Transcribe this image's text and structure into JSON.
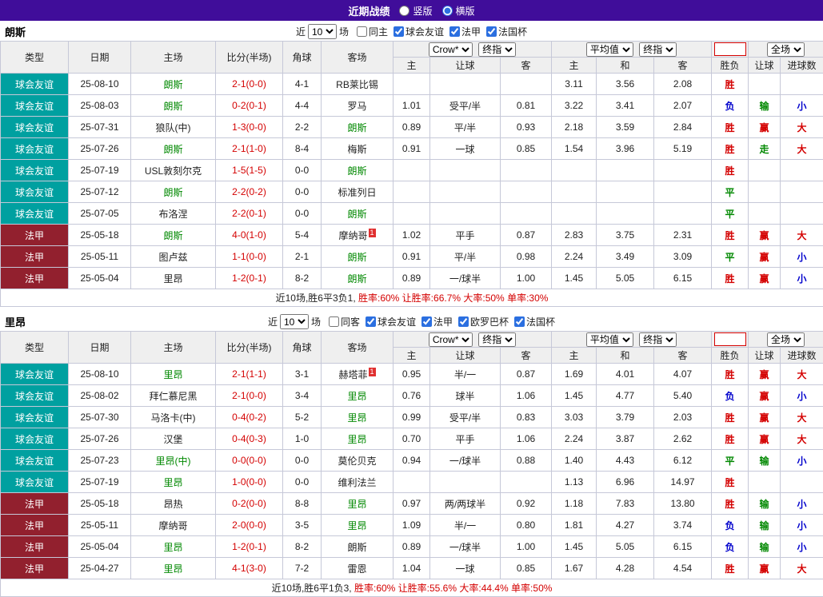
{
  "topbar": {
    "title": "近期战绩",
    "radios": [
      {
        "label": "竖版",
        "checked": false
      },
      {
        "label": "横版",
        "checked": true
      }
    ]
  },
  "table_header": {
    "cols": [
      "类型",
      "日期",
      "主场",
      "比分(半场)",
      "角球",
      "客场"
    ],
    "dropdowns": {
      "company": "Crow*",
      "final1": "终指",
      "average": "平均值",
      "final2": "终指",
      "fulltime": "全场"
    },
    "sub": [
      "主",
      "让球",
      "客",
      "主",
      "和",
      "客",
      "胜负",
      "让球",
      "进球数"
    ]
  },
  "colors": {
    "topbar_purple": "#400d9a",
    "type_friendly_teal": "#00a0a0",
    "type_league_maroon": "#92202e",
    "focus_team_green": "#008800",
    "score_red": "#d40000",
    "win_red": "#d40000",
    "lose_blue": "#0000cc",
    "draw_green": "#008800"
  },
  "sections": [
    {
      "team": "朗斯",
      "filter": {
        "prefix": "近",
        "count": "10",
        "suffix": "场",
        "checkboxes": [
          {
            "label": "同主",
            "checked": false
          },
          {
            "label": "球会友谊",
            "checked": true
          },
          {
            "label": "法甲",
            "checked": true
          },
          {
            "label": "法国杯",
            "checked": true
          }
        ]
      },
      "rows": [
        {
          "type": "球会友谊",
          "date": "25-08-10",
          "home": "朗斯",
          "home_focus": true,
          "score": "2-1(0-0)",
          "corner": "4-1",
          "away": "RB莱比锡",
          "odds": [
            "",
            "",
            ""
          ],
          "avg": [
            "3.11",
            "3.56",
            "2.08"
          ],
          "result": [
            "胜",
            "",
            ""
          ]
        },
        {
          "type": "球会友谊",
          "date": "25-08-03",
          "home": "朗斯",
          "home_focus": true,
          "score": "0-2(0-1)",
          "corner": "4-4",
          "away": "罗马",
          "odds": [
            "1.01",
            "受平/半",
            "0.81"
          ],
          "avg": [
            "3.22",
            "3.41",
            "2.07"
          ],
          "result": [
            "负",
            "输",
            "小"
          ]
        },
        {
          "type": "球会友谊",
          "date": "25-07-31",
          "home": "狼队(中)",
          "score": "1-3(0-0)",
          "corner": "2-2",
          "away": "朗斯",
          "away_focus": true,
          "odds": [
            "0.89",
            "平/半",
            "0.93"
          ],
          "avg": [
            "2.18",
            "3.59",
            "2.84"
          ],
          "result": [
            "胜",
            "赢",
            "大"
          ]
        },
        {
          "type": "球会友谊",
          "date": "25-07-26",
          "home": "朗斯",
          "home_focus": true,
          "score": "2-1(1-0)",
          "corner": "8-4",
          "away": "梅斯",
          "odds": [
            "0.91",
            "一球",
            "0.85"
          ],
          "avg": [
            "1.54",
            "3.96",
            "5.19"
          ],
          "result": [
            "胜",
            "走",
            "大"
          ]
        },
        {
          "type": "球会友谊",
          "date": "25-07-19",
          "home": "USL敦刻尔克",
          "score": "1-5(1-5)",
          "corner": "0-0",
          "away": "朗斯",
          "away_focus": true,
          "odds": [
            "",
            "",
            ""
          ],
          "avg": [
            "",
            "",
            ""
          ],
          "result": [
            "胜",
            "",
            ""
          ]
        },
        {
          "type": "球会友谊",
          "date": "25-07-12",
          "home": "朗斯",
          "home_focus": true,
          "score": "2-2(0-2)",
          "corner": "0-0",
          "away": "标准列日",
          "odds": [
            "",
            "",
            ""
          ],
          "avg": [
            "",
            "",
            ""
          ],
          "result": [
            "平",
            "",
            ""
          ]
        },
        {
          "type": "球会友谊",
          "date": "25-07-05",
          "home": "布洛涅",
          "score": "2-2(0-1)",
          "corner": "0-0",
          "away": "朗斯",
          "away_focus": true,
          "odds": [
            "",
            "",
            ""
          ],
          "avg": [
            "",
            "",
            ""
          ],
          "result": [
            "平",
            "",
            ""
          ]
        },
        {
          "type": "法甲",
          "date": "25-05-18",
          "home": "朗斯",
          "home_focus": true,
          "score": "4-0(1-0)",
          "corner": "5-4",
          "away": "摩纳哥",
          "away_sup": "1",
          "odds": [
            "1.02",
            "平手",
            "0.87"
          ],
          "avg": [
            "2.83",
            "3.75",
            "2.31"
          ],
          "result": [
            "胜",
            "赢",
            "大"
          ]
        },
        {
          "type": "法甲",
          "date": "25-05-11",
          "home": "图卢兹",
          "score": "1-1(0-0)",
          "corner": "2-1",
          "away": "朗斯",
          "away_focus": true,
          "odds": [
            "0.91",
            "平/半",
            "0.98"
          ],
          "avg": [
            "2.24",
            "3.49",
            "3.09"
          ],
          "result": [
            "平",
            "赢",
            "小"
          ]
        },
        {
          "type": "法甲",
          "date": "25-05-04",
          "home": "里昂",
          "score": "1-2(0-1)",
          "corner": "8-2",
          "away": "朗斯",
          "away_focus": true,
          "odds": [
            "0.89",
            "一/球半",
            "1.00"
          ],
          "avg": [
            "1.45",
            "5.05",
            "6.15"
          ],
          "result": [
            "胜",
            "赢",
            "小"
          ]
        }
      ],
      "summary": {
        "record": "近10场,胜6平3负1,",
        "stats": "胜率:60% 让胜率:66.7% 大率:50% 单率:30%"
      }
    },
    {
      "team": "里昂",
      "filter": {
        "prefix": "近",
        "count": "10",
        "suffix": "场",
        "checkboxes": [
          {
            "label": "同客",
            "checked": false
          },
          {
            "label": "球会友谊",
            "checked": true
          },
          {
            "label": "法甲",
            "checked": true
          },
          {
            "label": "欧罗巴杯",
            "checked": true
          },
          {
            "label": "法国杯",
            "checked": true
          }
        ]
      },
      "rows": [
        {
          "type": "球会友谊",
          "date": "25-08-10",
          "home": "里昂",
          "home_focus": true,
          "score": "2-1(1-1)",
          "corner": "3-1",
          "away": "赫塔菲",
          "away_sup": "1",
          "odds": [
            "0.95",
            "半/一",
            "0.87"
          ],
          "avg": [
            "1.69",
            "4.01",
            "4.07"
          ],
          "result": [
            "胜",
            "赢",
            "大"
          ]
        },
        {
          "type": "球会友谊",
          "date": "25-08-02",
          "home": "拜仁慕尼黑",
          "score": "2-1(0-0)",
          "corner": "3-4",
          "away": "里昂",
          "away_focus": true,
          "odds": [
            "0.76",
            "球半",
            "1.06"
          ],
          "avg": [
            "1.45",
            "4.77",
            "5.40"
          ],
          "result": [
            "负",
            "赢",
            "小"
          ]
        },
        {
          "type": "球会友谊",
          "date": "25-07-30",
          "home": "马洛卡(中)",
          "score": "0-4(0-2)",
          "corner": "5-2",
          "away": "里昂",
          "away_focus": true,
          "odds": [
            "0.99",
            "受平/半",
            "0.83"
          ],
          "avg": [
            "3.03",
            "3.79",
            "2.03"
          ],
          "result": [
            "胜",
            "赢",
            "大"
          ]
        },
        {
          "type": "球会友谊",
          "date": "25-07-26",
          "home": "汉堡",
          "score": "0-4(0-3)",
          "corner": "1-0",
          "away": "里昂",
          "away_focus": true,
          "odds": [
            "0.70",
            "平手",
            "1.06"
          ],
          "avg": [
            "2.24",
            "3.87",
            "2.62"
          ],
          "result": [
            "胜",
            "赢",
            "大"
          ]
        },
        {
          "type": "球会友谊",
          "date": "25-07-23",
          "home": "里昂(中)",
          "home_focus": true,
          "score": "0-0(0-0)",
          "corner": "0-0",
          "away": "莫伦贝克",
          "odds": [
            "0.94",
            "一/球半",
            "0.88"
          ],
          "avg": [
            "1.40",
            "4.43",
            "6.12"
          ],
          "result": [
            "平",
            "输",
            "小"
          ]
        },
        {
          "type": "球会友谊",
          "date": "25-07-19",
          "home": "里昂",
          "home_focus": true,
          "score": "1-0(0-0)",
          "corner": "0-0",
          "away": "维利法兰",
          "odds": [
            "",
            "",
            ""
          ],
          "avg": [
            "1.13",
            "6.96",
            "14.97"
          ],
          "result": [
            "胜",
            "",
            ""
          ]
        },
        {
          "type": "法甲",
          "date": "25-05-18",
          "home": "昂热",
          "score": "0-2(0-0)",
          "corner": "8-8",
          "away": "里昂",
          "away_focus": true,
          "odds": [
            "0.97",
            "两/两球半",
            "0.92"
          ],
          "avg": [
            "1.18",
            "7.83",
            "13.80"
          ],
          "result": [
            "胜",
            "输",
            "小"
          ]
        },
        {
          "type": "法甲",
          "date": "25-05-11",
          "home": "摩纳哥",
          "score": "2-0(0-0)",
          "corner": "3-5",
          "away": "里昂",
          "away_focus": true,
          "odds": [
            "1.09",
            "半/一",
            "0.80"
          ],
          "avg": [
            "1.81",
            "4.27",
            "3.74"
          ],
          "result": [
            "负",
            "输",
            "小"
          ]
        },
        {
          "type": "法甲",
          "date": "25-05-04",
          "home": "里昂",
          "home_focus": true,
          "score": "1-2(0-1)",
          "corner": "8-2",
          "away": "朗斯",
          "odds": [
            "0.89",
            "一/球半",
            "1.00"
          ],
          "avg": [
            "1.45",
            "5.05",
            "6.15"
          ],
          "result": [
            "负",
            "输",
            "小"
          ]
        },
        {
          "type": "法甲",
          "date": "25-04-27",
          "home": "里昂",
          "home_focus": true,
          "score": "4-1(3-0)",
          "corner": "7-2",
          "away": "雷恩",
          "odds": [
            "1.04",
            "一球",
            "0.85"
          ],
          "avg": [
            "1.67",
            "4.28",
            "4.54"
          ],
          "result": [
            "胜",
            "赢",
            "大"
          ]
        }
      ],
      "summary": {
        "record": "近10场,胜6平1负3,",
        "stats": "胜率:60% 让胜率:55.6% 大率:44.4% 单率:50%"
      }
    }
  ]
}
